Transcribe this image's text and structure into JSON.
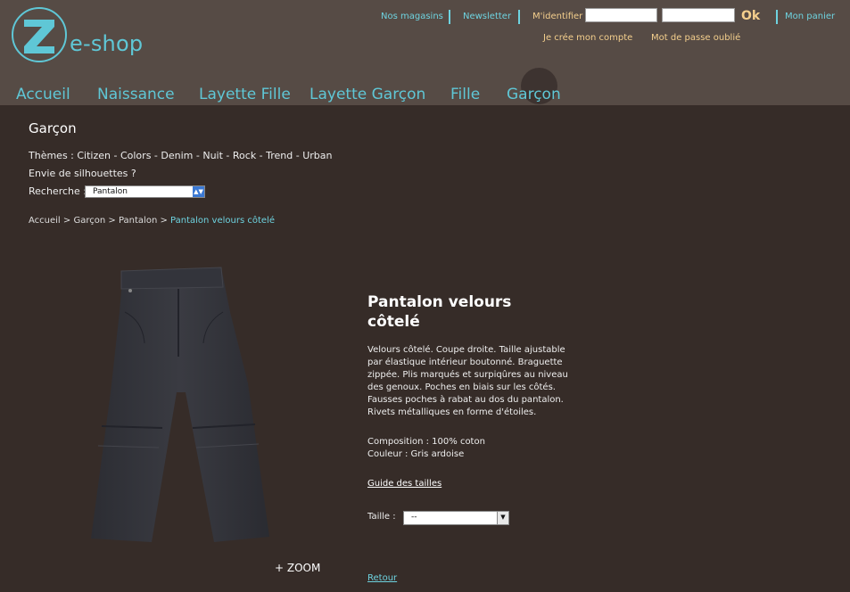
{
  "brand": {
    "logo_letter": "Z",
    "name": "e-shop"
  },
  "colors": {
    "accent": "#5fc7d6",
    "secondary": "#f4cf8d",
    "header_bg": "#564b45",
    "page_bg": "#362c28"
  },
  "toplinks": {
    "stores": "Nos magasins",
    "newsletter": "Newsletter",
    "cart": "Mon panier"
  },
  "login": {
    "label": "M'identifier",
    "ok": "Ok",
    "create_account": "Je crée mon compte",
    "forgot_password": "Mot de passe oublié"
  },
  "nav": [
    "Accueil",
    "Naissance",
    "Layette Fille",
    "Layette Garçon",
    "Fille",
    "Garçon"
  ],
  "section": {
    "title": "Garçon",
    "themes_label": "Thèmes :",
    "themes": [
      "Citizen",
      "Colors",
      "Denim",
      "Nuit",
      "Rock",
      "Trend",
      "Urban"
    ],
    "silhouettes": "Envie de silhouettes ?",
    "search_label": "Recherche :",
    "search_value": "Pantalon"
  },
  "breadcrumb": {
    "home": "Accueil",
    "category": "Garçon",
    "subcategory": "Pantalon",
    "current": "Pantalon velours côtelé"
  },
  "product": {
    "title": "Pantalon velours côtelé",
    "description": "Velours côtelé. Coupe droite. Taille ajustable par élastique intérieur boutonné. Braguette zippée. Plis marqués et surpiqûres au niveau des genoux. Poches en biais sur les côtés. Fausses poches à rabat au dos du pantalon. Rivets métalliques en forme d'étoiles.",
    "composition": "Composition : 100% coton",
    "color": "Couleur : Gris ardoise",
    "size_guide": "Guide des tailles",
    "size_label": "Taille :",
    "size_value": "--",
    "zoom": "+ ZOOM",
    "back": "Retour"
  }
}
